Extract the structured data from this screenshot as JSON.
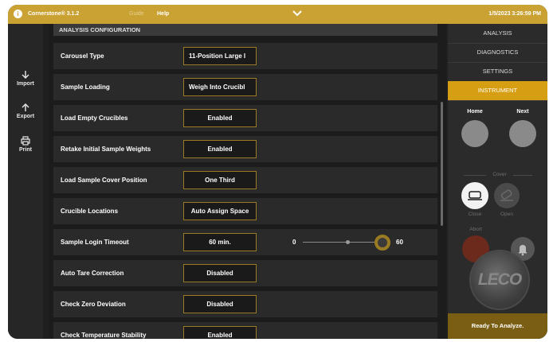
{
  "topbar": {
    "app_icon": "i",
    "app_title": "Cornerstone® 3.1.2",
    "guide": "Guide",
    "help": "Help",
    "datetime": "1/5/2023 3:26:59 PM"
  },
  "leftnav": {
    "items": [
      {
        "label": "Import",
        "icon": "arrow-down-icon"
      },
      {
        "label": "Export",
        "icon": "arrow-up-icon"
      },
      {
        "label": "Print",
        "icon": "printer-icon"
      }
    ]
  },
  "config": {
    "header": "ANALYSIS CONFIGURATION",
    "rows": [
      {
        "label": "Carousel Type",
        "value": "11-Position Large I"
      },
      {
        "label": "Sample Loading",
        "value": "Weigh Into Crucibl"
      },
      {
        "label": "Load Empty Crucibles",
        "value": "Enabled"
      },
      {
        "label": "Retake Initial Sample Weights",
        "value": "Enabled"
      },
      {
        "label": "Load Sample Cover Position",
        "value": "One Third"
      },
      {
        "label": "Crucible Locations",
        "value": "Auto Assign Space"
      },
      {
        "label": "Sample Login Timeout",
        "value": "60 min."
      },
      {
        "label": "Auto Tare Correction",
        "value": "Disabled"
      },
      {
        "label": "Check Zero Deviation",
        "value": "Disabled"
      },
      {
        "label": "Check Temperature Stability",
        "value": "Enabled"
      }
    ],
    "timeout_slider": {
      "min": "0",
      "max": "60",
      "value": 60
    }
  },
  "right_panel": {
    "tabs": [
      "ANALYSIS",
      "DIAGNOSTICS",
      "SETTINGS",
      "INSTRUMENT"
    ],
    "active_tab": "INSTRUMENT",
    "home": "Home",
    "next": "Next",
    "cover": "Cover",
    "close": "Close",
    "open": "Open",
    "abort": "Abort",
    "logo": "LECO",
    "status": "Ready To Analyze."
  }
}
